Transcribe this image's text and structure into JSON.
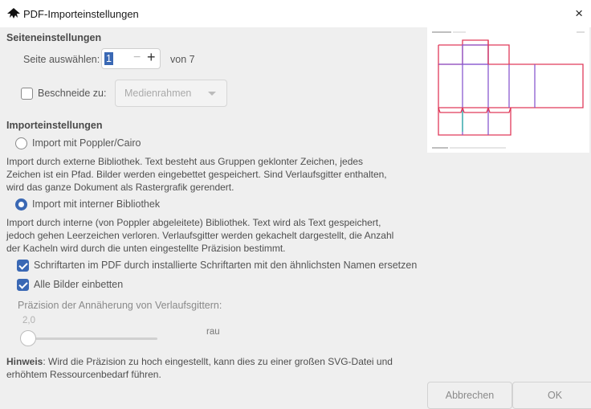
{
  "window": {
    "title": "PDF-Importeinstellungen",
    "close_label": "×"
  },
  "page_settings": {
    "heading": "Seiteneinstellungen",
    "select_page_label": "Seite auswählen:",
    "page_value": "1",
    "minus": "−",
    "plus": "+",
    "of_label": "von 7",
    "crop_label": "Beschneide zu:",
    "crop_checked": false,
    "crop_option": "Medienrahmen"
  },
  "import_settings": {
    "heading": "Importeinstellungen",
    "option_poppler": {
      "label": "Import mit Poppler/Cairo",
      "selected": false,
      "description_lines": [
        "Import durch externe Bibliothek. Text besteht aus Gruppen geklonter Zeichen, jedes",
        "Zeichen ist ein Pfad. Bilder werden eingebettet gespeichert. Sind Verlaufsgitter enthalten,",
        "wird das ganze Dokument als Rastergrafik gerendert."
      ]
    },
    "option_internal": {
      "label": "Import mit interner Bibliothek",
      "selected": true,
      "description_lines": [
        "Import durch interne (von Poppler abgeleitete) Bibliothek. Text wird als Text gespeichert,",
        "jedoch gehen Leerzeichen verloren. Verlaufsgitter werden gekachelt dargestellt, die Anzahl",
        "der Kacheln wird durch die unten eingestellte Präzision bestimmt."
      ]
    },
    "replace_fonts": {
      "label": "Schriftarten im PDF durch installierte Schriftarten mit den ähnlichsten Namen ersetzen",
      "checked": true
    },
    "embed_images": {
      "label": "Alle Bilder einbetten",
      "checked": true
    },
    "precision_label": "Präzision der Annäherung von Verlaufsgittern:",
    "precision_value": "2,0",
    "precision_quality": "rau",
    "hint_bold": "Hinweis",
    "hint_line1": ": Wird die Präzision zu hoch eingestellt, kann dies zu einer großen SVG-Datei und",
    "hint_line2": "erhöhtem Ressourcenbedarf führen."
  },
  "buttons": {
    "cancel": "Abbrechen",
    "ok": "OK"
  },
  "colors": {
    "accent": "#3a68b4",
    "preview_red": "#e03a5a",
    "preview_purple": "#8a5ad0",
    "preview_teal": "#2bb5a5"
  },
  "icons": {
    "app": "inkscape-icon",
    "close": "close-icon"
  }
}
